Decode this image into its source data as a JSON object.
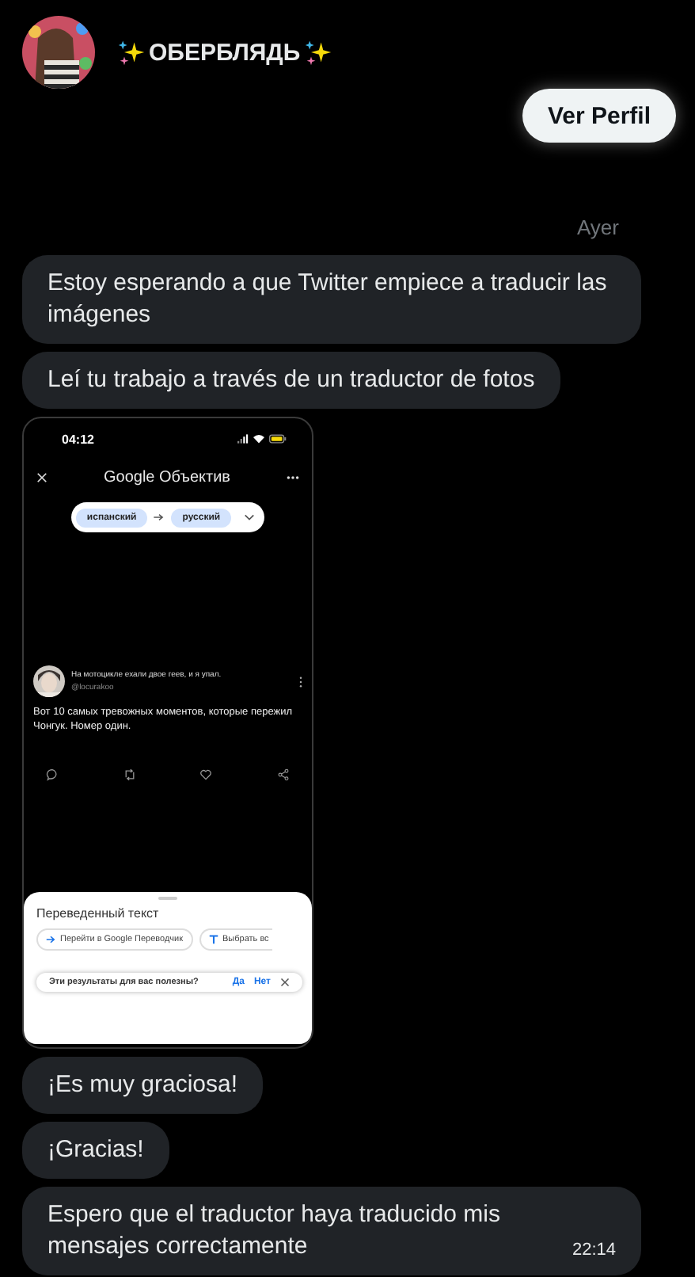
{
  "header": {
    "name": "ОБЕРБЛЯДЬ",
    "profile_button": "Ver Perfil"
  },
  "day_label": "Ayer",
  "messages": [
    {
      "kind": "text",
      "text": "Estoy esperando a que Twitter empiece a traducir las imágenes"
    },
    {
      "kind": "text",
      "text": "Leí tu trabajo a través de un traductor de fotos"
    },
    {
      "shot": {
        "status_time": "04:12",
        "app_title": "Google Объектив",
        "source_lang": "испанский",
        "target_lang": "русский",
        "tweet_title": "На мотоцикле ехали двое геев, и я упал.",
        "tweet_handle": "@locurakoo",
        "tweet_text": "Вот 10 самых тревожных моментов, которые пережил Чонгук. Номер один.",
        "sheet_title": "Переведенный текст",
        "chips": [
          "Перейти в Google Переводчик",
          "Выбрать вс"
        ],
        "feedback_question": "Эти результаты для вас полезны?",
        "feedback_yes": "Да",
        "feedback_no": "Нет"
      }
    },
    {
      "kind": "text",
      "text": "¡Es muy graciosa!"
    },
    {
      "kind": "text",
      "text": "¡Gracias!"
    },
    {
      "kind": "text",
      "text": "Espero que el traductor haya traducido mis mensajes correctamente",
      "time": "22:14"
    }
  ]
}
